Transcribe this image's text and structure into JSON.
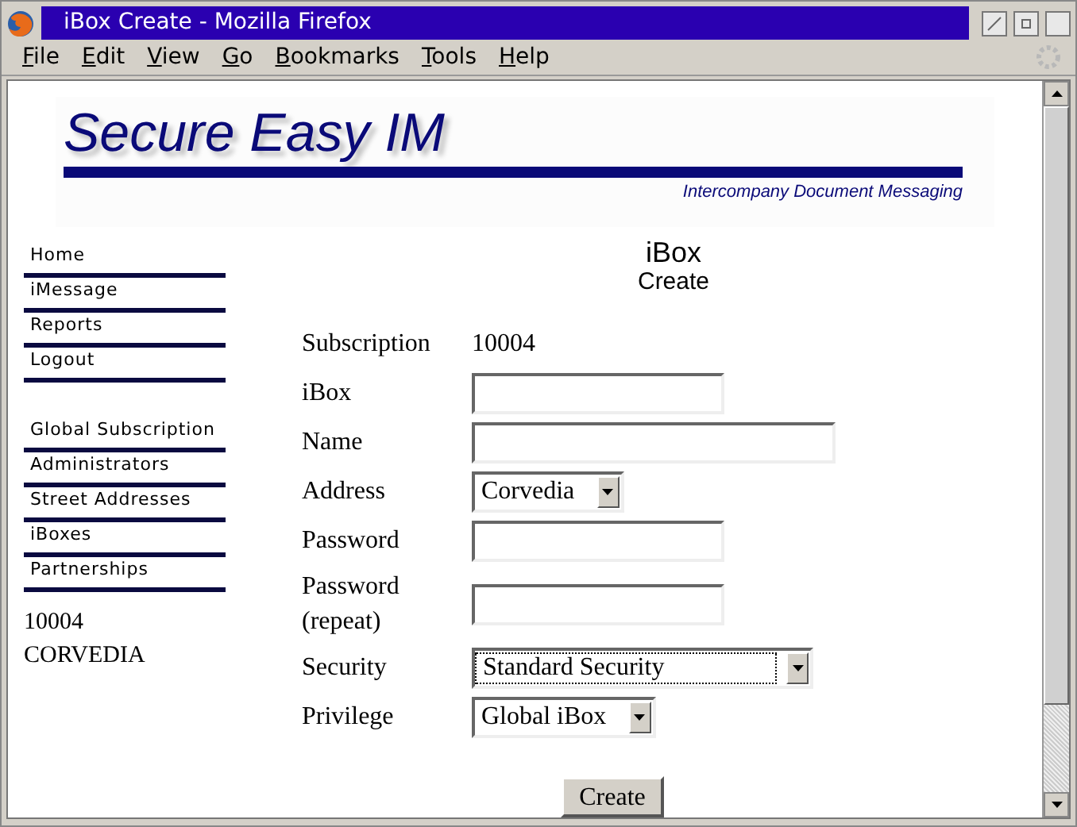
{
  "window": {
    "title": "iBox Create - Mozilla Firefox"
  },
  "menu": [
    "File",
    "Edit",
    "View",
    "Go",
    "Bookmarks",
    "Tools",
    "Help"
  ],
  "banner": {
    "title": "Secure Easy IM",
    "subtitle": "Intercompany Document Messaging"
  },
  "sidebar": {
    "groups": [
      [
        "Home",
        "iMessage",
        "Reports",
        "Logout"
      ],
      [
        "Global Subscription",
        "Administrators",
        "Street Addresses",
        "iBoxes",
        "Partnerships"
      ]
    ],
    "info": [
      "10004",
      "CORVEDIA"
    ]
  },
  "heading": {
    "title": "iBox",
    "subtitle": "Create"
  },
  "form": [
    {
      "label": "Subscription",
      "kind": "value",
      "value": "10004"
    },
    {
      "label": "iBox",
      "kind": "short-input"
    },
    {
      "label": "Name",
      "kind": "long-input"
    },
    {
      "label": "Address",
      "kind": "select",
      "value": "Corvedia",
      "focused": false
    },
    {
      "label": "Password",
      "kind": "short-input"
    },
    {
      "label": "Password (repeat)",
      "kind": "short-input"
    },
    {
      "label": "Security",
      "kind": "select",
      "value": "Standard Security",
      "focused": true
    },
    {
      "label": "Privilege",
      "kind": "select",
      "value": "Global iBox",
      "focused": false
    }
  ],
  "submit": "Create"
}
